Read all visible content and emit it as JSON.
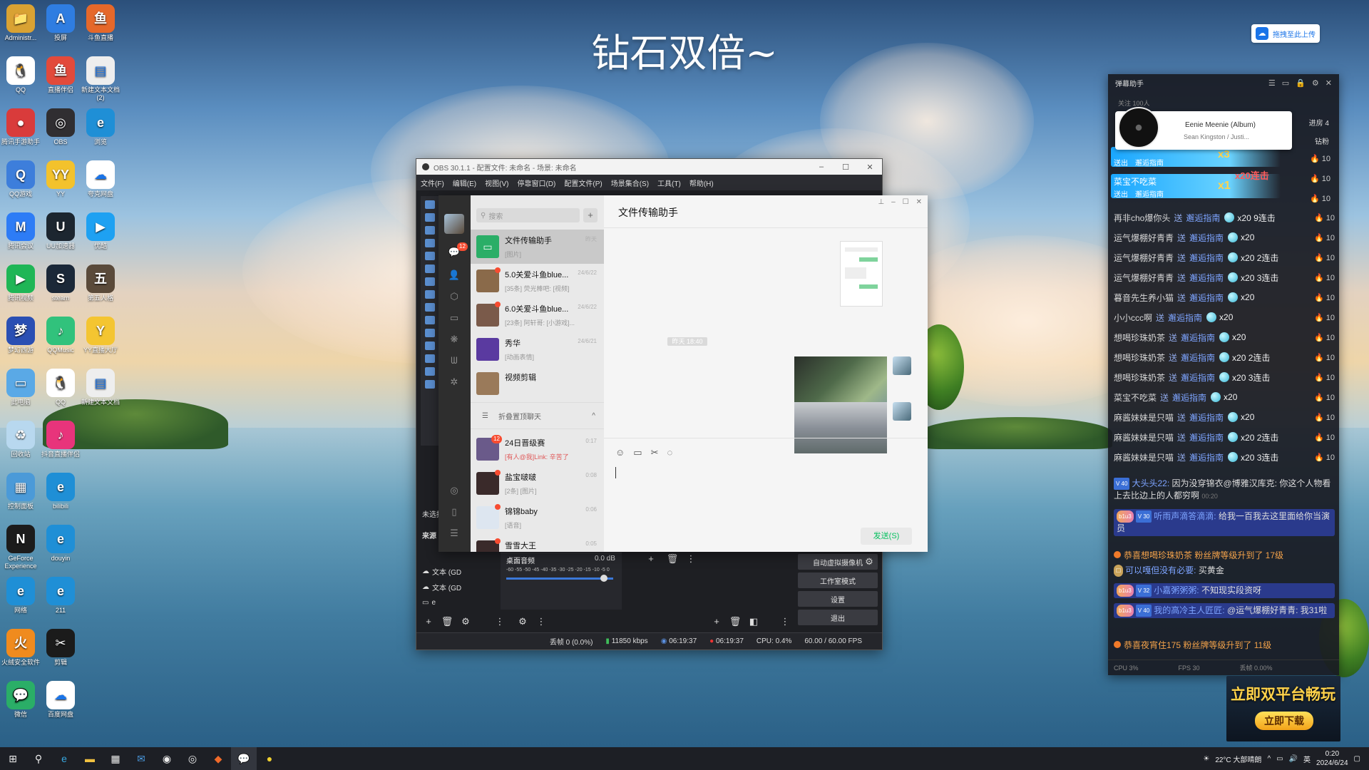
{
  "wallpaper_title": "钻石双倍~",
  "desktop_icons": [
    {
      "label": "Administr...",
      "col": 0,
      "row": 0,
      "color": "#d9a233",
      "glyph": "📁"
    },
    {
      "label": "投屏",
      "col": 1,
      "row": 0,
      "color": "#2f7de1",
      "glyph": "A"
    },
    {
      "label": "斗鱼直播",
      "col": 2,
      "row": 0,
      "color": "#e5682a",
      "glyph": "鱼"
    },
    {
      "label": "QQ",
      "col": 0,
      "row": 1,
      "color": "#ffffff",
      "glyph": "🐧"
    },
    {
      "label": "直播伴侣",
      "col": 1,
      "row": 1,
      "color": "#e24a3b",
      "glyph": "鱼"
    },
    {
      "label": "新建文本文档 (2)",
      "col": 2,
      "row": 1,
      "color": "#eeeeee",
      "glyph": "▤"
    },
    {
      "label": "腾讯手游助手",
      "col": 0,
      "row": 2,
      "color": "#d93b3b",
      "glyph": "●"
    },
    {
      "label": "OBS",
      "col": 1,
      "row": 2,
      "color": "#302e31",
      "glyph": "◎"
    },
    {
      "label": "浏览",
      "col": 2,
      "row": 2,
      "color": "#1f8fd6",
      "glyph": "e"
    },
    {
      "label": "QQ游戏",
      "col": 0,
      "row": 3,
      "color": "#3d7edb",
      "glyph": "Q"
    },
    {
      "label": "YY",
      "col": 1,
      "row": 3,
      "color": "#f3c22c",
      "glyph": "YY"
    },
    {
      "label": "夸克网盘",
      "col": 2,
      "row": 3,
      "color": "#ffffff",
      "glyph": "☁"
    },
    {
      "label": "腾讯会议",
      "col": 0,
      "row": 4,
      "color": "#2d7cf6",
      "glyph": "M"
    },
    {
      "label": "UU加速器",
      "col": 1,
      "row": 4,
      "color": "#1c2630",
      "glyph": "U"
    },
    {
      "label": "优酷",
      "col": 2,
      "row": 4,
      "color": "#1ea1f2",
      "glyph": "▶"
    },
    {
      "label": "腾讯视频",
      "col": 0,
      "row": 5,
      "color": "#1fb656",
      "glyph": "▶"
    },
    {
      "label": "steam",
      "col": 1,
      "row": 5,
      "color": "#1b2838",
      "glyph": "S"
    },
    {
      "label": "第五人格",
      "col": 2,
      "row": 5,
      "color": "#5a4a3a",
      "glyph": "五"
    },
    {
      "label": "梦幻西游",
      "col": 0,
      "row": 6,
      "color": "#2a4fb3",
      "glyph": "梦"
    },
    {
      "label": "QQMusic",
      "col": 1,
      "row": 6,
      "color": "#31c27c",
      "glyph": "♪"
    },
    {
      "label": "YY直播大厅",
      "col": 2,
      "row": 6,
      "color": "#f4c531",
      "glyph": "Y"
    },
    {
      "label": "此电脑",
      "col": 0,
      "row": 7,
      "color": "#5aa9e6",
      "glyph": "▭"
    },
    {
      "label": "QQ",
      "col": 1,
      "row": 7,
      "color": "#ffffff",
      "glyph": "🐧"
    },
    {
      "label": "新建文本文档",
      "col": 2,
      "row": 7,
      "color": "#eeeeee",
      "glyph": "▤"
    },
    {
      "label": "回收站",
      "col": 0,
      "row": 8,
      "color": "#b8d8ef",
      "glyph": "♻"
    },
    {
      "label": "抖音直播伴侣",
      "col": 1,
      "row": 8,
      "color": "#e8347b",
      "glyph": "♪"
    },
    {
      "label": "控制面板",
      "col": 0,
      "row": 9,
      "color": "#4b9ad8",
      "glyph": "▦"
    },
    {
      "label": "bilibili",
      "col": 1,
      "row": 9,
      "color": "#1f8fd6",
      "glyph": "e"
    },
    {
      "label": "GeForce Experience",
      "col": 0,
      "row": 10,
      "color": "#1c1c1c",
      "glyph": "N"
    },
    {
      "label": "douyin",
      "col": 1,
      "row": 10,
      "color": "#1f8fd6",
      "glyph": "e"
    },
    {
      "label": "网络",
      "col": 0,
      "row": 11,
      "color": "#1f8fd6",
      "glyph": "e"
    },
    {
      "label": "211",
      "col": 1,
      "row": 11,
      "color": "#1f8fd6",
      "glyph": "e"
    },
    {
      "label": "火绒安全软件",
      "col": 0,
      "row": 12,
      "color": "#f08b1e",
      "glyph": "火"
    },
    {
      "label": "剪辑",
      "col": 1,
      "row": 12,
      "color": "#1b1b1b",
      "glyph": "✂"
    },
    {
      "label": "微信",
      "col": 0,
      "row": 13,
      "color": "#2aae67",
      "glyph": "💬"
    },
    {
      "label": "百度网盘",
      "col": 1,
      "row": 13,
      "color": "#ffffff",
      "glyph": "☁"
    }
  ],
  "upload_button": {
    "label": "拖拽至此上传"
  },
  "obs": {
    "title": "OBS 30.1.1 - 配置文件: 未命名 - 场景: 未命名",
    "menu": [
      "文件(F)",
      "编辑(E)",
      "视图(V)",
      "停靠窗口(D)",
      "配置文件(P)",
      "场景集合(S)",
      "工具(T)",
      "帮助(H)"
    ],
    "scene_label": "未选择",
    "sources_label": "来源",
    "sources": [
      "文本 (GD",
      "文本 (GD",
      "e"
    ],
    "audio_name": "桌面音频",
    "audio_db": "0.0 dB",
    "meter_ticks": "-60 -55 -50 -45 -40 -35 -30 -25 -20 -15 -10 -5 0",
    "controls": [
      "自动虚拟摄像机",
      "工作室模式",
      "设置",
      "退出"
    ],
    "status": {
      "dropped": "丢帧 0 (0.0%)",
      "bitrate": "11850 kbps",
      "live_time": "06:19:37",
      "rec_time": "06:19:37",
      "cpu": "CPU: 0.4%",
      "fps": "60.00 / 60.00 FPS"
    }
  },
  "wechat": {
    "search_placeholder": "搜索",
    "nav_badge": "12",
    "chats": [
      {
        "name": "文件传输助手",
        "preview": "[图片]",
        "time": "昨天",
        "selected": true,
        "color": "#2aae67",
        "dot": false
      },
      {
        "name": "5.0关爱斗鱼blue...",
        "preview": "[35条] 荧光棒吧: [视频]",
        "time": "24/6/22",
        "selected": false,
        "color": "#8a6a4a",
        "dot": true
      },
      {
        "name": "6.0关爱斗鱼blue...",
        "preview": "[23条] 阿轩哥: [小游戏]...",
        "time": "24/6/22",
        "selected": false,
        "color": "#7a5a4a",
        "dot": true
      },
      {
        "name": "秀华",
        "preview": "[动画表情]",
        "time": "24/6/21",
        "selected": false,
        "color": "#5a3aa0",
        "dot": false
      },
      {
        "name": "视频剪辑",
        "preview": "",
        "time": "",
        "selected": false,
        "color": "#9a7a5a",
        "dot": false
      }
    ],
    "fold_label": "折叠置顶聊天",
    "chats2": [
      {
        "name": "24日晋级赛",
        "preview": "[有人@我]Link: 辛苦了",
        "time": "0:17",
        "color": "#6a5a8a",
        "badge": "12"
      },
      {
        "name": "盐宝啵啵",
        "preview": "[2条] [图片]",
        "time": "0:08",
        "color": "#3a2a2a",
        "dot": true
      },
      {
        "name": "锦锦baby",
        "preview": "[语音]",
        "time": "0:06",
        "color": "#dde6f0",
        "dot": true
      },
      {
        "name": "雪雪大王",
        "preview": "[3条] 今晚开挂打屁屁",
        "time": "0:05",
        "color": "#3a2a2a",
        "dot": true
      }
    ],
    "chat_title": "文件传输助手",
    "timestamp": "昨天 18:40",
    "send_label": "发送(S)"
  },
  "danmu": {
    "title": "弹幕助手",
    "follow": "关注 100人",
    "song_title": "Eenie Meenie (Album)",
    "song_artist": "Sean Kingston / Justi...",
    "enter": "进房 4",
    "diamond": "钻粉",
    "hl1": {
      "u": "送出",
      "g": "邂逅指南",
      "n": "x3"
    },
    "hl2": {
      "name": "菜宝不吃菜",
      "u": "送出",
      "g": "邂逅指南",
      "n": "x1",
      "combo": "x20连击"
    },
    "gifts": [
      {
        "u": "再非cho爆你头",
        "g": "邂逅指南",
        "n": "x20 9连击",
        "r": "10"
      },
      {
        "u": "运气爆棚好青青",
        "g": "邂逅指南",
        "n": "x20",
        "r": "10"
      },
      {
        "u": "运气爆棚好青青",
        "g": "邂逅指南",
        "n": "x20 2连击",
        "r": "10"
      },
      {
        "u": "运气爆棚好青青",
        "g": "邂逅指南",
        "n": "x20 3连击",
        "r": "10"
      },
      {
        "u": "暮音先生养小猫",
        "g": "邂逅指南",
        "n": "x20",
        "r": "10"
      },
      {
        "u": "小小ccc啊",
        "g": "邂逅指南",
        "n": "x20",
        "r": "10"
      },
      {
        "u": "想喝珍珠奶茶",
        "g": "邂逅指南",
        "n": "x20",
        "r": "10"
      },
      {
        "u": "想喝珍珠奶茶",
        "g": "邂逅指南",
        "n": "x20 2连击",
        "r": "10"
      },
      {
        "u": "想喝珍珠奶茶",
        "g": "邂逅指南",
        "n": "x20 3连击",
        "r": "10"
      },
      {
        "u": "菜宝不吃菜",
        "g": "邂逅指南",
        "n": "x20",
        "r": "10"
      },
      {
        "u": "麻酱妹妹是只喵",
        "g": "邂逅指南",
        "n": "x20",
        "r": "10"
      },
      {
        "u": "麻酱妹妹是只喵",
        "g": "邂逅指南",
        "n": "x20 2连击",
        "r": "10"
      },
      {
        "u": "麻酱妹妹是只喵",
        "g": "邂逅指南",
        "n": "x20 3连击",
        "r": "10"
      }
    ],
    "send_word": "送",
    "comments": [
      {
        "lv": "V 40",
        "nick": "大头头22:",
        "text": "因为没穿锦衣@博雅汉库克: 你这个人物看上去比边上的人都穷啊",
        "time": "00:20"
      },
      {
        "lv": "V 30",
        "nick": "听雨声滴答滴滴:",
        "text": "给我一百我去这里面给你当演员",
        "time": "",
        "bd": "b1u3"
      },
      {
        "lv": "V 32",
        "nick": "小嘉粥粥粥:",
        "text": "不知现实段资呀",
        "time": "",
        "bd": "b1u3"
      },
      {
        "lv": "V 40",
        "nick": "我的高冷主人匠匠:",
        "text": "@运气爆棚好青青: 我31啦",
        "time": "",
        "bd": "b1u3"
      }
    ],
    "notice1": "恭喜想喝珍珠奶茶 粉丝牌等级升到了 17级",
    "comment_short": {
      "nick": "可以嘎但没有必要:",
      "text": "买黄金"
    },
    "notice2": "恭喜夜宵住175 粉丝牌等级升到了 11级",
    "foot": [
      "CPU 3%",
      "FPS 30",
      "丢帧 0.00%"
    ]
  },
  "promo": {
    "headline": "立即双平台畅玩",
    "button": "立即下载"
  },
  "taskbar": {
    "weather": "22°C 大部晴朗",
    "lang": "英",
    "time": "0:20",
    "date": "2024/6/24"
  }
}
